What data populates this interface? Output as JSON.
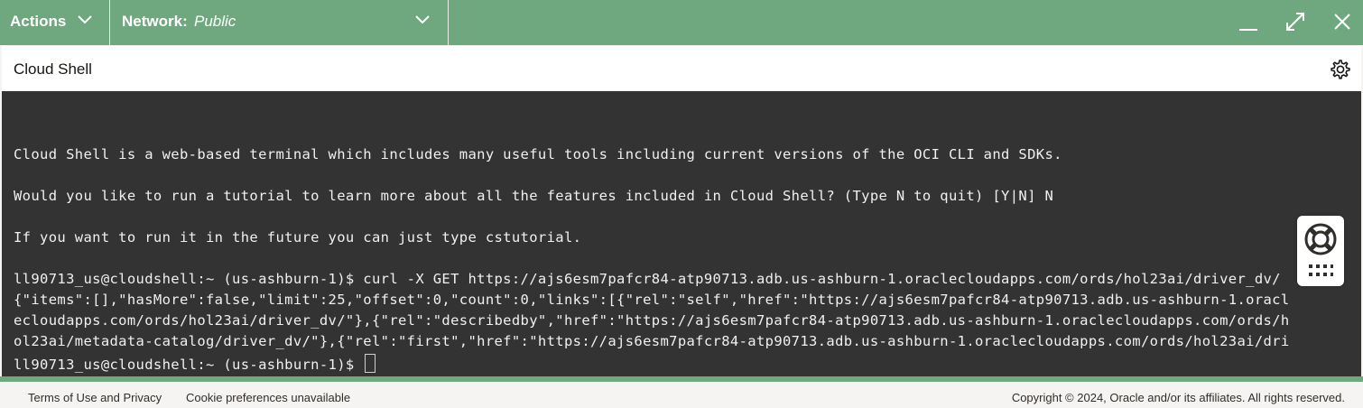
{
  "topbar": {
    "actions_label": "Actions",
    "network_label": "Network:",
    "network_value": "Public"
  },
  "panel": {
    "title": "Cloud Shell"
  },
  "terminal": {
    "lines": [
      "Cloud Shell is a web-based terminal which includes many useful tools including current versions of the OCI CLI and SDKs.",
      "Would you like to run a tutorial to learn more about all the features included in Cloud Shell? (Type N to quit) [Y|N] N",
      "If you want to run it in the future you can just type cstutorial.",
      "ll90713_us@cloudshell:~ (us-ashburn-1)$ curl -X GET https://ajs6esm7pafcr84-atp90713.adb.us-ashburn-1.oraclecloudapps.com/ords/hol23ai/driver_dv/",
      "{\"items\":[],\"hasMore\":false,\"limit\":25,\"offset\":0,\"count\":0,\"links\":[{\"rel\":\"self\",\"href\":\"https://ajs6esm7pafcr84-atp90713.adb.us-ashburn-1.oracl",
      "ecloudapps.com/ords/hol23ai/driver_dv/\"},{\"rel\":\"describedby\",\"href\":\"https://ajs6esm7pafcr84-atp90713.adb.us-ashburn-1.oraclecloudapps.com/ords/h",
      "ol23ai/metadata-catalog/driver_dv/\"},{\"rel\":\"first\",\"href\":\"https://ajs6esm7pafcr84-atp90713.adb.us-ashburn-1.oraclecloudapps.com/ords/hol23ai/dri",
      "ll90713_us@cloudshell:~ (us-ashburn-1)$ "
    ]
  },
  "footer": {
    "terms": "Terms of Use and Privacy",
    "cookies": "Cookie preferences unavailable",
    "copyright": "Copyright © 2024, Oracle and/or its affiliates. All rights reserved."
  },
  "colors": {
    "topbar": "#6fa87f",
    "terminal_bg": "#333333",
    "terminal_text": "#f0f0f0",
    "footer_bg": "#f5f4f2"
  },
  "icons": [
    "chevron-down-icon",
    "minimize-icon",
    "maximize-icon",
    "close-icon",
    "gear-icon",
    "lifebuoy-icon",
    "keypad-icon"
  ]
}
